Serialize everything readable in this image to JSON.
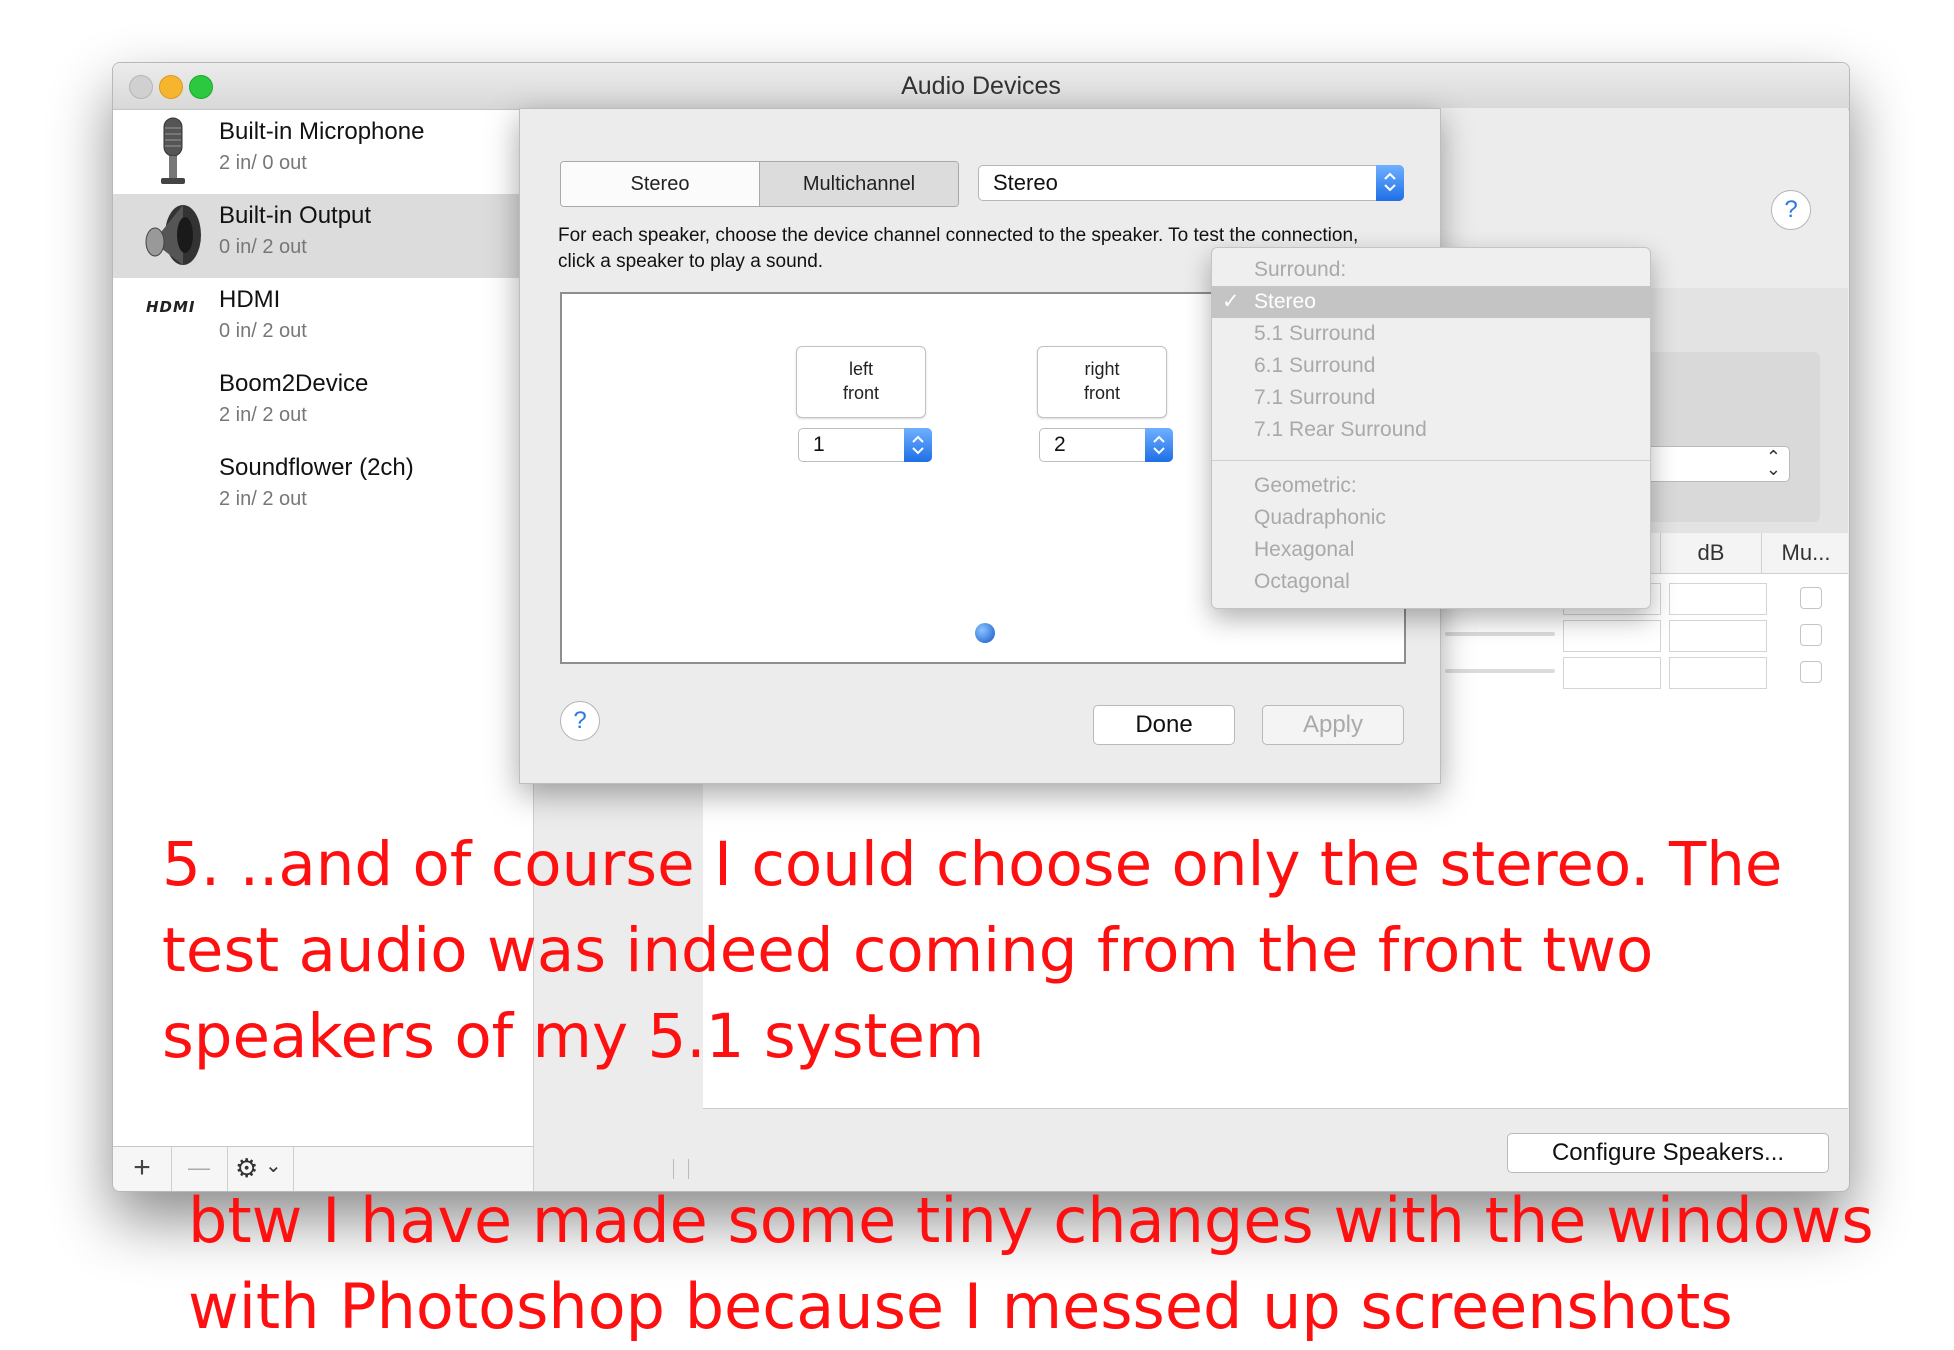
{
  "window": {
    "title": "Audio Devices",
    "traffic_lights": {
      "close": "#c9c9c9",
      "minimize": "#f5b52e",
      "zoom": "#2bc840"
    }
  },
  "devices": [
    {
      "name": "Built-in Microphone",
      "io": "2 in/ 0 out",
      "icon": "microphone-icon",
      "selected": false
    },
    {
      "name": "Built-in Output",
      "io": "0 in/ 2 out",
      "icon": "speaker-icon",
      "selected": true
    },
    {
      "name": "HDMI",
      "io": "0 in/ 2 out",
      "icon": "hdmi-icon",
      "selected": false
    },
    {
      "name": "Boom2Device",
      "io": "2 in/ 2 out",
      "icon": "",
      "selected": false
    },
    {
      "name": "Soundflower (2ch)",
      "io": "2 in/ 2 out",
      "icon": "",
      "selected": false
    }
  ],
  "sidebar_toolbar": {
    "add": "+",
    "remove": "—",
    "gear_chevron": "⌄"
  },
  "dialog": {
    "segments": [
      "Stereo",
      "Multichannel"
    ],
    "active_segment": "Multichannel",
    "mode_popup_value": "Stereo",
    "instructions": "For each speaker, choose the device channel connected to the speaker. To test the connection, click a speaker to play a sound.",
    "speakers": [
      {
        "label_line1": "left",
        "label_line2": "front",
        "channel": "1"
      },
      {
        "label_line1": "right",
        "label_line2": "front",
        "channel": "2"
      }
    ],
    "help": "?",
    "done_label": "Done",
    "apply_label": "Apply"
  },
  "menu": {
    "surround_header": "Surround:",
    "items": [
      "Stereo",
      "5.1 Surround",
      "6.1 Surround",
      "7.1 Surround",
      "7.1 Rear Surround"
    ],
    "checked": "Stereo",
    "checkmark": "✓",
    "geometric_header": "Geometric:",
    "geometric_items": [
      "Quadraphonic",
      "Hexagonal",
      "Octagonal"
    ]
  },
  "right_pane": {
    "help": "?",
    "col_db": "dB",
    "col_mute": "Mu...",
    "configure_label": "Configure Speakers..."
  },
  "annotations": {
    "main_line1": "5. ..and of course I could choose only the stereo. The",
    "main_line2": "test audio was indeed coming from the front two",
    "main_line3": "speakers of my 5.1 system",
    "bottom_line1": "btw I have made some tiny changes with the windows",
    "bottom_line2": "with Photoshop because I messed up screenshots"
  }
}
